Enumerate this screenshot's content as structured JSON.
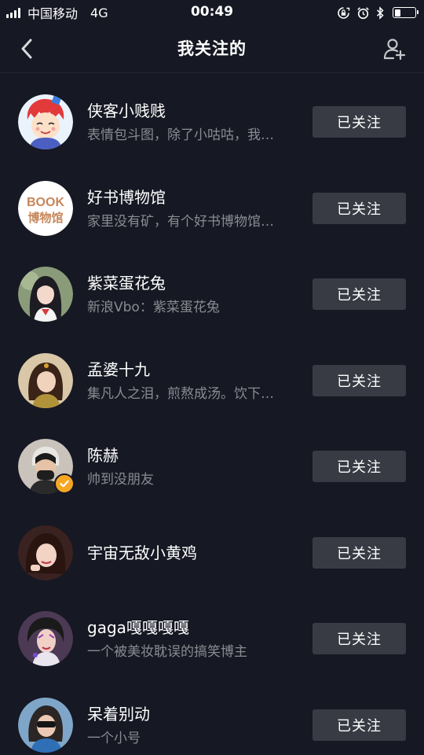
{
  "status_bar": {
    "carrier": "中国移动",
    "network": "4G",
    "time": "00:49",
    "battery_level": 0.3
  },
  "nav": {
    "title": "我关注的",
    "back_icon": "chevron-left-icon",
    "add_icon": "add-user-icon"
  },
  "users": [
    {
      "name": "侠客小贱贱",
      "desc": "表情包斗图，除了小咕咕，我…",
      "button": "已关注",
      "verified": false
    },
    {
      "name": "好书博物馆",
      "desc": "家里没有矿，有个好书博物馆…",
      "button": "已关注",
      "verified": false,
      "avatar_text_top": "BOOK",
      "avatar_text_bottom": "博物馆"
    },
    {
      "name": "紫菜蛋花兔",
      "desc": "新浪Vbo：紫菜蛋花兔",
      "button": "已关注",
      "verified": false
    },
    {
      "name": "孟婆十九",
      "desc": "集凡人之泪，煎熬成汤。饮下…",
      "button": "已关注",
      "verified": false
    },
    {
      "name": "陈赫",
      "desc": "帅到没朋友",
      "button": "已关注",
      "verified": true
    },
    {
      "name": "宇宙无敌小黄鸡",
      "desc": "",
      "button": "已关注",
      "verified": false
    },
    {
      "name": "gaga嘎嘎嘎嘎",
      "desc": "一个被美妆耽误的搞笑博主",
      "button": "已关注",
      "verified": false
    },
    {
      "name": "呆着别动",
      "desc": "一个小号",
      "button": "已关注",
      "verified": false
    }
  ]
}
